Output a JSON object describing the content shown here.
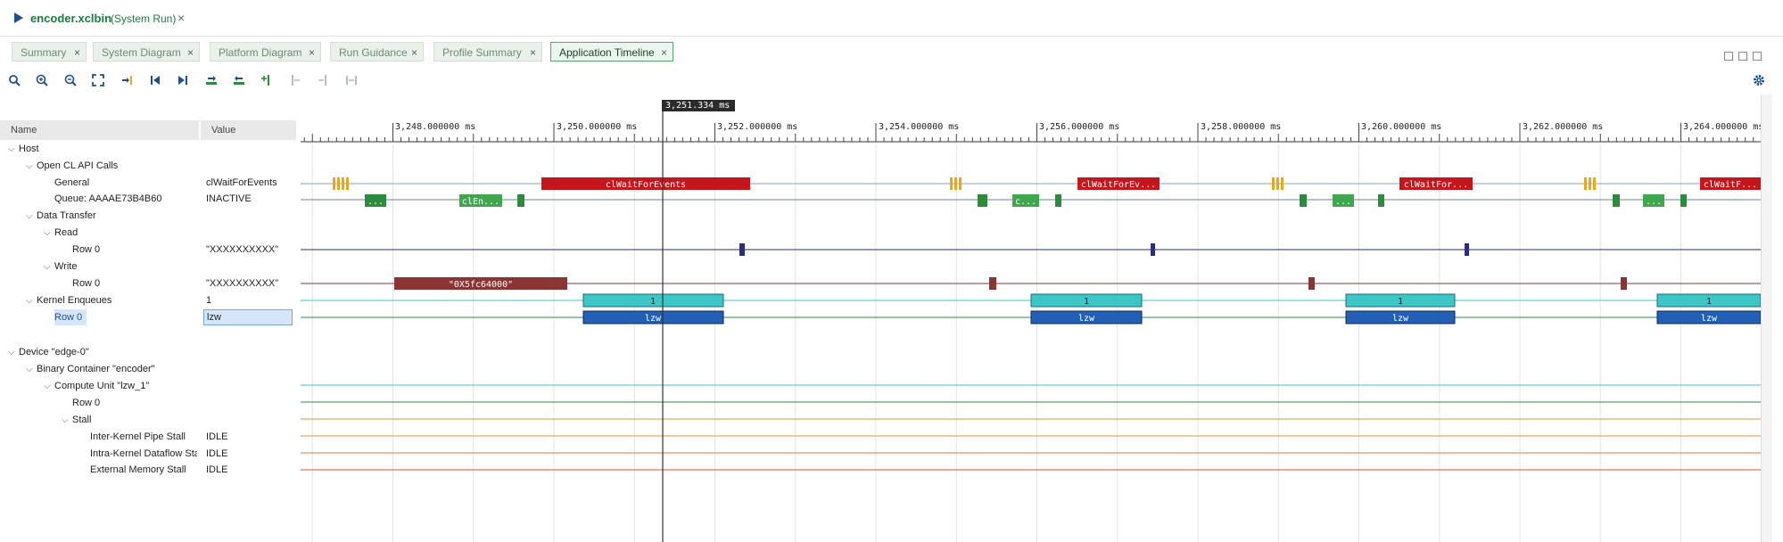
{
  "title": {
    "name": "encoder.xclbin",
    "subtitle": "(System Run)",
    "close": "×"
  },
  "tabs": [
    {
      "label": "Summary",
      "close": "×"
    },
    {
      "label": "System Diagram",
      "close": "×"
    },
    {
      "label": "Platform Diagram",
      "close": "×"
    },
    {
      "label": "Run Guidance",
      "close": "×"
    },
    {
      "label": "Profile Summary",
      "close": "×"
    },
    {
      "label": "Application Timeline",
      "close": "×"
    }
  ],
  "columns": {
    "name": "Name",
    "value": "Value"
  },
  "tree": {
    "host": "Host",
    "open_cl": "Open CL API Calls",
    "general": "General",
    "general_value": "clWaitForEvents",
    "queue": "Queue: AAAAE73B4B60",
    "queue_value": "INACTIVE",
    "data_transfer": "Data Transfer",
    "read": "Read",
    "read_row": "Row 0",
    "read_value": "\"XXXXXXXXXX\"",
    "write": "Write",
    "write_row": "Row 0",
    "write_value": "\"XXXXXXXXXX\"",
    "kernel_enqueues": "Kernel Enqueues",
    "kernel_enqueues_value": "1",
    "kernel_row": "Row 0",
    "kernel_row_value": "lzw",
    "device": "Device \"edge-0\"",
    "binary_container": "Binary Container \"encoder\"",
    "compute_unit": "Compute Unit \"lzw_1\"",
    "cu_row": "Row 0",
    "stall": "Stall",
    "inter_kernel": "Inter-Kernel Pipe Stall",
    "inter_kernel_value": "IDLE",
    "intra_kernel": "Intra-Kernel Dataflow Sta",
    "intra_kernel_value": "IDLE",
    "ext_mem": "External Memory Stall",
    "ext_mem_value": "IDLE"
  },
  "timeline": {
    "cursor_label": "3,251.334 ms",
    "ticks": [
      "3,248.000000 ms",
      "3,250.000000 ms",
      "3,252.000000 ms",
      "3,254.000000 ms",
      "3,256.000000 ms",
      "3,258.000000 ms",
      "3,260.000000 ms",
      "3,262.000000 ms",
      "3,264.000000 ms"
    ],
    "general_bars": [
      "clWaitForEvents",
      "clWaitForEv...",
      "clWaitFor...",
      "clWaitF..."
    ],
    "queue_bars": [
      "...",
      "clEn...",
      "...",
      "c...",
      "...",
      "..."
    ],
    "write_bar": "\"0X5fc64000\"",
    "enqueue_bars": [
      "1",
      "1",
      "1",
      "1"
    ],
    "kernel_bars": [
      "lzw",
      "lzw",
      "lzw",
      "lzw"
    ]
  },
  "icons": [
    "search-icon",
    "zoom-in-icon",
    "zoom-out-icon",
    "zoom-fit-icon",
    "go-to-cursor-icon",
    "first-icon",
    "last-icon",
    "next-event-icon",
    "prev-event-icon",
    "add-marker-icon",
    "marker-a-icon",
    "marker-b-icon",
    "marker-range-icon",
    "settings-gear-icon"
  ],
  "colors": {
    "accent_green": "#1b7a3e",
    "api_red": "#c4161c",
    "api_orange": "#e8a81c",
    "queue_green": "#2e8b3d",
    "write_brown": "#8b3434",
    "read_navy": "#2a2f7a",
    "enqueue_teal": "#3cc6c6",
    "kernel_blue": "#2360b5"
  }
}
